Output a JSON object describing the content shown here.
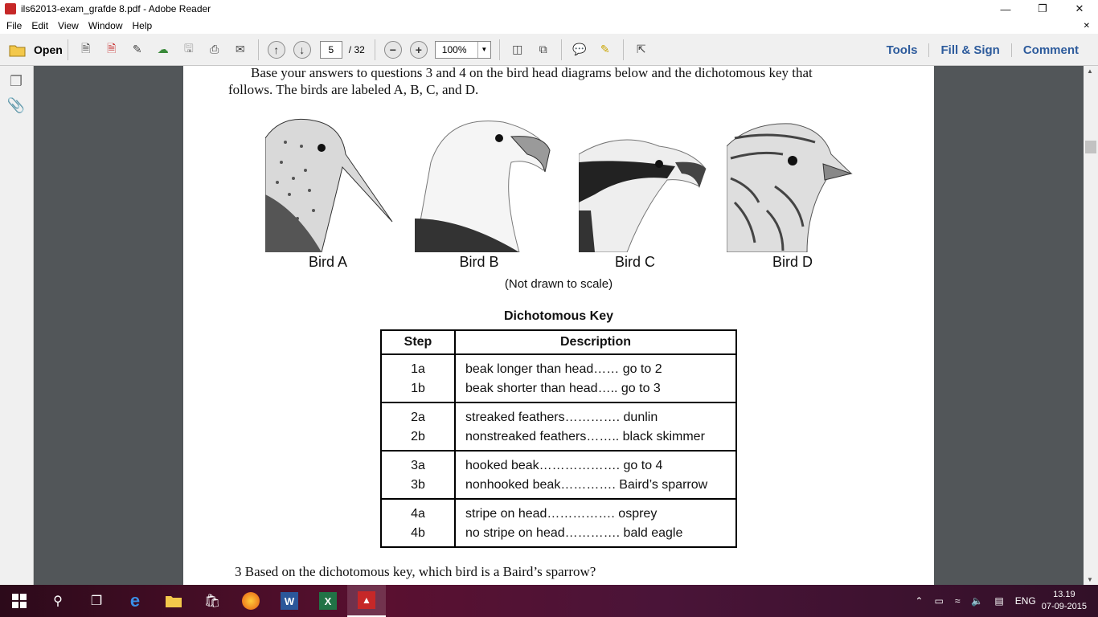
{
  "window": {
    "title": "ils62013-exam_grafde 8.pdf - Adobe Reader"
  },
  "menu": [
    "File",
    "Edit",
    "View",
    "Window",
    "Help"
  ],
  "toolbar": {
    "open_label": "Open",
    "page_current": "5",
    "page_total": "/ 32",
    "zoom": "100%",
    "right_links": [
      "Tools",
      "Fill & Sign",
      "Comment"
    ]
  },
  "document": {
    "intro_line1": "Base your answers to questions 3 and 4 on the bird head diagrams below and the dichotomous key that",
    "intro_line2": "follows. The birds are labeled A, B, C, and D.",
    "birds": [
      "Bird A",
      "Bird B",
      "Bird C",
      "Bird D"
    ],
    "scale_note": "(Not drawn to scale)",
    "key_title": "Dichotomous Key",
    "key_headers": [
      "Step",
      "Description"
    ],
    "key_groups": [
      [
        {
          "step": "1a",
          "desc": "beak longer than head…… go to 2"
        },
        {
          "step": "1b",
          "desc": "beak shorter than head….. go to 3"
        }
      ],
      [
        {
          "step": "2a",
          "desc": "streaked feathers…………. dunlin"
        },
        {
          "step": "2b",
          "desc": "nonstreaked feathers…….. black skimmer"
        }
      ],
      [
        {
          "step": "3a",
          "desc": "hooked beak………………. go to 4"
        },
        {
          "step": "3b",
          "desc": "nonhooked beak…………. Baird’s sparrow"
        }
      ],
      [
        {
          "step": "4a",
          "desc": "stripe on head……………. osprey"
        },
        {
          "step": "4b",
          "desc": "no stripe on head…………. bald eagle"
        }
      ]
    ],
    "question3": "3  Based on the dichotomous key, which bird is a Baird’s sparrow?"
  },
  "taskbar": {
    "lang": "ENG",
    "time": "13.19",
    "date": "07-09-2015"
  },
  "colors": {
    "accent_links": "#2d5b9c",
    "doc_bg": "#525659"
  }
}
